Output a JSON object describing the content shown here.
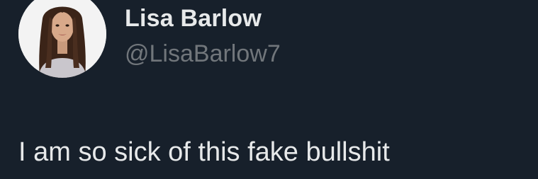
{
  "tweet": {
    "author": {
      "display_name": "Lisa Barlow",
      "handle": "@LisaBarlow7"
    },
    "text": "I am so sick of this fake bullshit"
  },
  "colors": {
    "background": "#17202b",
    "name_text": "#e7e9ea",
    "handle_text": "#71767b",
    "body_text": "#e7e9ea"
  }
}
